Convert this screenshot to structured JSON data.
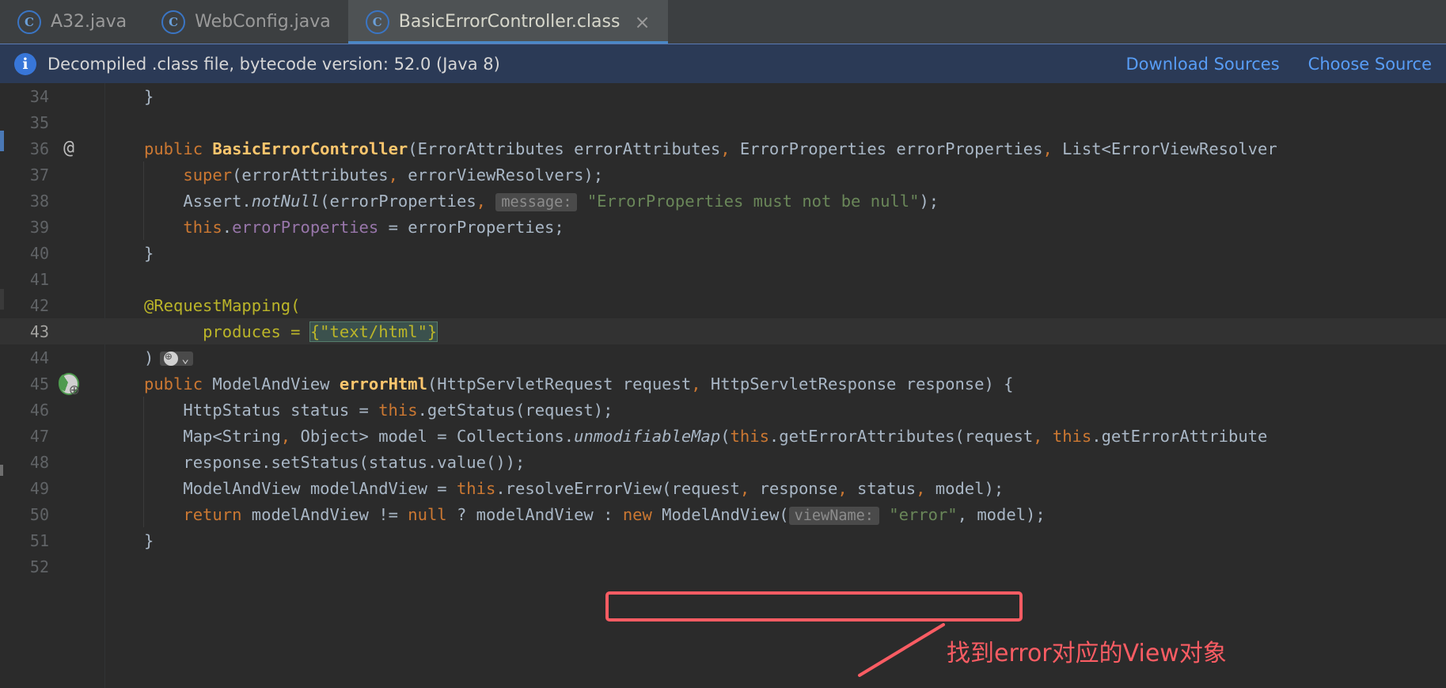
{
  "tabs": [
    {
      "label": "A32.java",
      "icon": "class-file-icon",
      "active": false,
      "closable": false
    },
    {
      "label": "WebConfig.java",
      "icon": "class-file-icon",
      "active": false,
      "closable": false
    },
    {
      "label": "BasicErrorController.class",
      "icon": "class-file-icon",
      "active": true,
      "closable": true,
      "close_glyph": "×"
    }
  ],
  "notification": {
    "icon": "info-icon",
    "icon_glyph": "i",
    "text": "Decompiled .class file, bytecode version: 52.0 (Java 8)",
    "actions": [
      {
        "label": "Download Sources"
      },
      {
        "label": "Choose Source"
      }
    ],
    "bg_color": "#2b3a56",
    "link_color": "#589df6"
  },
  "editor": {
    "current_line": 43,
    "lines": [
      {
        "n": "34",
        "mark": "",
        "indent_guides": []
      },
      {
        "n": "35",
        "mark": "",
        "indent_guides": []
      },
      {
        "n": "36",
        "mark": "at",
        "indent_guides": []
      },
      {
        "n": "37",
        "mark": "",
        "indent_guides": [
          1
        ]
      },
      {
        "n": "38",
        "mark": "",
        "indent_guides": [
          1
        ]
      },
      {
        "n": "39",
        "mark": "",
        "indent_guides": [
          1
        ]
      },
      {
        "n": "40",
        "mark": "",
        "indent_guides": []
      },
      {
        "n": "41",
        "mark": "",
        "indent_guides": []
      },
      {
        "n": "42",
        "mark": "",
        "indent_guides": []
      },
      {
        "n": "43",
        "mark": "",
        "indent_guides": []
      },
      {
        "n": "44",
        "mark": "",
        "indent_guides": []
      },
      {
        "n": "45",
        "mark": "globe",
        "indent_guides": []
      },
      {
        "n": "46",
        "mark": "",
        "indent_guides": [
          1
        ]
      },
      {
        "n": "47",
        "mark": "",
        "indent_guides": [
          1
        ]
      },
      {
        "n": "48",
        "mark": "",
        "indent_guides": [
          1
        ]
      },
      {
        "n": "49",
        "mark": "",
        "indent_guides": [
          1
        ]
      },
      {
        "n": "50",
        "mark": "",
        "indent_guides": [
          1
        ]
      },
      {
        "n": "51",
        "mark": "",
        "indent_guides": []
      },
      {
        "n": "52",
        "mark": "",
        "indent_guides": []
      }
    ],
    "code_text": {
      "l34": "}",
      "l36": "public BasicErrorController(ErrorAttributes errorAttributes, ErrorProperties errorProperties, List<ErrorViewResolver",
      "l37": "super(errorAttributes, errorViewResolvers);",
      "l38_a": "Assert.notNull(errorProperties,",
      "l38_hint": "message:",
      "l38_str": "\"ErrorProperties must not be null\"",
      "l38_end": ");",
      "l39": "this.errorProperties = errorProperties;",
      "l40": "}",
      "l42": "@RequestMapping(",
      "l43_a": "produces = ",
      "l43_b": "{\"text/html\"}",
      "l44": ")",
      "l45": "public ModelAndView errorHtml(HttpServletRequest request, HttpServletResponse response) {",
      "l46": "HttpStatus status = this.getStatus(request);",
      "l47": "Map<String, Object> model = Collections.unmodifiableMap(this.getErrorAttributes(request, this.getErrorAttribute",
      "l48": "response.setStatus(status.value());",
      "l49": "ModelAndView modelAndView = this.resolveErrorView(request, response, status, model);",
      "l50_a": "return modelAndView != null ? modelAndView : ",
      "l50_box_kw": "new",
      "l50_box_type": " ModelAndView(",
      "l50_box_hint": "viewName:",
      "l50_box_str": "\"error\"",
      "l50_box_end": ", model);",
      "l51": "}"
    }
  },
  "annotation": {
    "note_text": "找到error对应的View对象",
    "color": "#fa5c63",
    "highlight_target": "new ModelAndView( viewName: \"error\", model);"
  }
}
